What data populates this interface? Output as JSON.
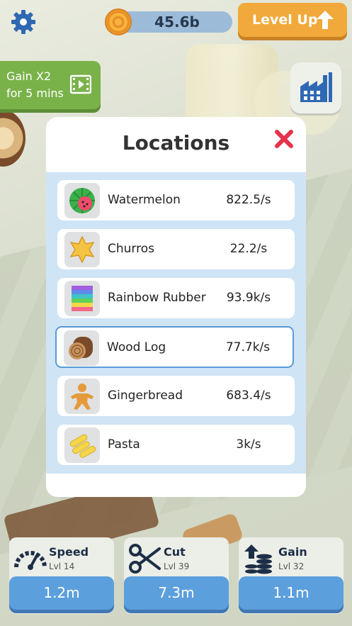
{
  "topbar": {
    "settings_icon": "gear-icon",
    "currency_value": "45.6b",
    "coin_icon": "wood-coin-icon",
    "level_up_label": "Level Up",
    "level_up_icon": "arrow-up-icon"
  },
  "gain_ad": {
    "line1": "Gain X2",
    "line2": "for 5 mins",
    "icon": "video-film-icon"
  },
  "factory_button": {
    "icon": "factory-icon"
  },
  "locations": {
    "title": "Locations",
    "close_icon": "close-x-icon",
    "items": [
      {
        "name": "Watermelon",
        "rate": "822.5/s",
        "icon": "watermelon-icon",
        "selected": false
      },
      {
        "name": "Churros",
        "rate": "22.2/s",
        "icon": "churros-icon",
        "selected": false
      },
      {
        "name": "Rainbow Rubber",
        "rate": "93.9k/s",
        "icon": "rainbow-rubber-icon",
        "selected": false
      },
      {
        "name": "Wood Log",
        "rate": "77.7k/s",
        "icon": "wood-log-icon",
        "selected": true
      },
      {
        "name": "Gingerbread",
        "rate": "683.4/s",
        "icon": "gingerbread-icon",
        "selected": false
      },
      {
        "name": "Pasta",
        "rate": "3k/s",
        "icon": "pasta-icon",
        "selected": false
      }
    ]
  },
  "upgrades": [
    {
      "title": "Speed",
      "level": "Lvl 14",
      "cost": "1.2m",
      "icon": "speedometer-icon"
    },
    {
      "title": "Cut",
      "level": "Lvl 39",
      "cost": "7.3m",
      "icon": "scissors-icon"
    },
    {
      "title": "Gain",
      "level": "Lvl 32",
      "cost": "1.1m",
      "icon": "coin-stack-icon"
    }
  ],
  "colors": {
    "accent_blue": "#5c9fdd",
    "level_up_orange": "#f0a93a",
    "ad_green": "#7ab24a",
    "close_red": "#e4334b",
    "selected_border": "#5b9bd9"
  }
}
